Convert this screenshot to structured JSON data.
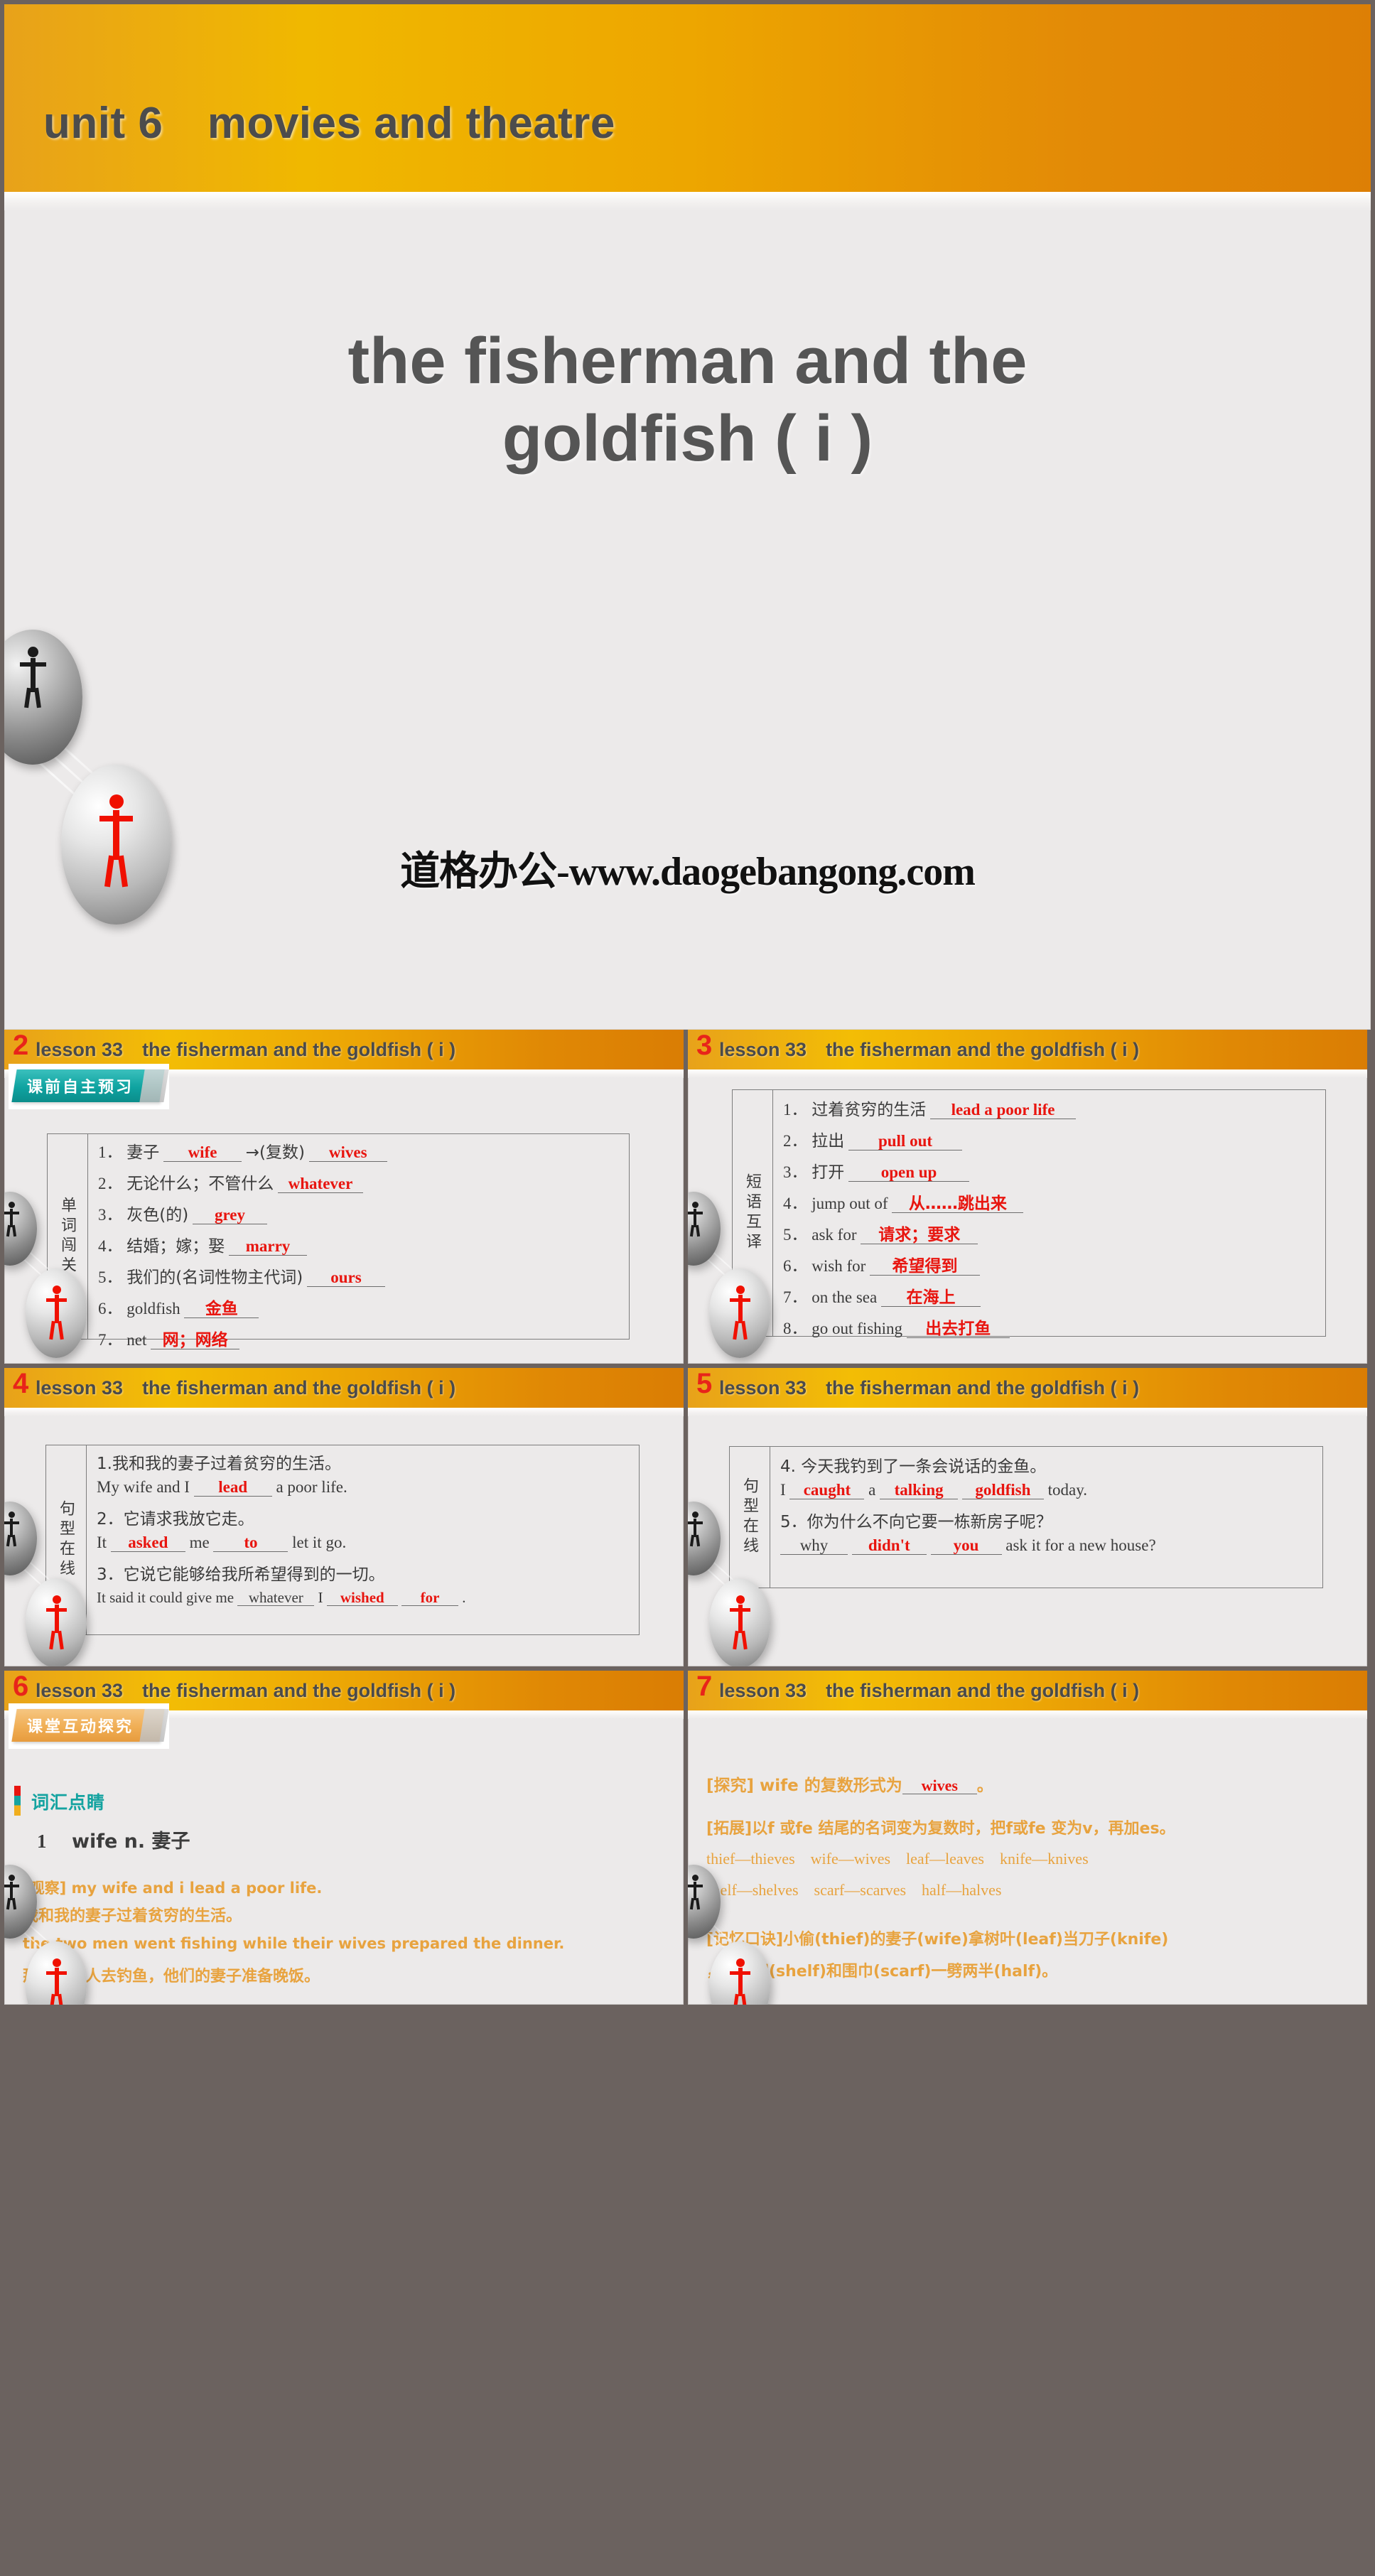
{
  "hero": {
    "unit_label": "unit 6 movies and theatre",
    "title_line1": "the fisherman and the",
    "title_line2": "goldfish ( i )",
    "watermark": "道格办公-www.daogebangong.com"
  },
  "colors": {
    "band_start": "#f0b800",
    "band_end": "#dd7f05",
    "slide_bg": "#eceaea",
    "answer_red": "#e8150f",
    "accent_orange": "#e8a33f",
    "accent_teal": "#14a3a0",
    "number_red": "#e8241a"
  },
  "slides": [
    {
      "number": "2",
      "title": "lesson 33 the fisherman and the goldfish ( i )",
      "tab": {
        "label": "课前自主预习",
        "style": "teal"
      },
      "table": {
        "side_label": "单词闯关",
        "rows": [
          {
            "num": "1．",
            "prompt": "妻子",
            "answers": [
              "wife"
            ],
            "mid": "→(复数)",
            "answers2": [
              "wives"
            ]
          },
          {
            "num": "2．",
            "prompt": "无论什么；不管什么",
            "answers": [
              "whatever"
            ]
          },
          {
            "num": "3．",
            "prompt": "灰色(的)",
            "answers": [
              "grey"
            ]
          },
          {
            "num": "4．",
            "prompt": "结婚；嫁；娶",
            "answers": [
              "marry"
            ]
          },
          {
            "num": "5．",
            "prompt": "我们的(名词性物主代词)",
            "answers": [
              "ours"
            ]
          },
          {
            "num": "6．",
            "prompt": "goldfish",
            "answers": [
              "金鱼"
            ]
          },
          {
            "num": "7．",
            "prompt": "net",
            "answers": [
              "网；网络"
            ]
          }
        ]
      }
    },
    {
      "number": "3",
      "title": "lesson 33 the fisherman and the goldfish ( i )",
      "table": {
        "side_label": "短语互译",
        "rows": [
          {
            "num": "1．",
            "prompt": "过着贫穷的生活",
            "answers": [
              "lead a poor life"
            ]
          },
          {
            "num": "2．",
            "prompt": "拉出",
            "answers": [
              "pull out"
            ]
          },
          {
            "num": "3．",
            "prompt": "打开",
            "answers": [
              "open up"
            ]
          },
          {
            "num": "4．",
            "prompt": "jump out of",
            "answers": [
              "从……跳出来"
            ]
          },
          {
            "num": "5．",
            "prompt": "ask for",
            "answers": [
              "请求；要求"
            ]
          },
          {
            "num": "6．",
            "prompt": "wish for",
            "answers": [
              "希望得到"
            ]
          },
          {
            "num": "7．",
            "prompt": "on the sea",
            "answers": [
              "在海上"
            ]
          },
          {
            "num": "8．",
            "prompt": "go out fishing",
            "answers": [
              "出去打鱼"
            ]
          }
        ]
      }
    },
    {
      "number": "4",
      "title": "lesson 33 the fisherman and the goldfish ( i )",
      "table": {
        "side_label": "句型在线",
        "sentences": [
          {
            "cn": "1.我和我的妻子过着贫穷的生活。",
            "en_pre": "My wife and I",
            "blanks": [
              "lead"
            ],
            "en_post": "a poor life."
          },
          {
            "cn": "2．它请求我放它走。",
            "en_pre": "It",
            "blanks": [
              "asked",
              "to"
            ],
            "mid": "me",
            "en_post": "let it go."
          },
          {
            "cn": "3．它说它能够给我所希望得到的一切。",
            "en_pre": "It said it could give me",
            "blanks": [
              "whatever",
              "I",
              "wished",
              "for"
            ],
            "en_post": "."
          }
        ]
      }
    },
    {
      "number": "5",
      "title": "lesson 33 the fisherman and the goldfish ( i )",
      "table": {
        "side_label": "句型在线",
        "sentences": [
          {
            "cn": "4. 今天我钓到了一条会说话的金鱼。",
            "en_pre": "I",
            "blanks": [
              "caught",
              "a",
              "talking",
              "goldfish"
            ],
            "en_post": "today."
          },
          {
            "cn": "5．你为什么不向它要一栋新房子呢？",
            "en_pre": "",
            "blanks": [
              "why",
              "didn't",
              "you"
            ],
            "en_post": "ask it for a new house?"
          }
        ]
      }
    },
    {
      "number": "6",
      "title": "lesson 33 the fisherman and the goldfish ( i )",
      "tab": {
        "label": "课堂互动探究",
        "style": "orange"
      },
      "section_heading": "词汇点睛",
      "entry_no": "1",
      "entry_word": "wife n. 妻子",
      "lines": [
        {
          "text": "[观察] my wife and i lead a poor life.",
          "bold": false
        },
        {
          "text": "我和我的妻子过着贫穷的生活。",
          "bold": true
        },
        {
          "text": "the two men went fishing while their wives prepared the dinner.",
          "bold": false
        },
        {
          "text": "那两个男人去钓鱼，他们的妻子准备晚饭。",
          "bold": true
        }
      ]
    },
    {
      "number": "7",
      "title": "lesson 33 the fisherman and the goldfish ( i )",
      "explore_pre": "[探究] wife 的复数形式为",
      "explore_answer": "wives",
      "explore_post": "。",
      "expand_line": "[拓展]以f 或fe 结尾的名词变为复数时，把f或fe 变为v，再加es。",
      "pairs_row1": "thief—thieves wife—wives leaf—leaves knife—knives",
      "pairs_row2": "shelf—shelves scarf—scarves half—halves",
      "mnemonic_line1": "[记忆口诀]小偷(thief)的妻子(wife)拿树叶(leaf)当刀子(knife)",
      "mnemonic_line2": "，将书架(shelf)和围巾(scarf)一劈两半(half)。"
    }
  ]
}
